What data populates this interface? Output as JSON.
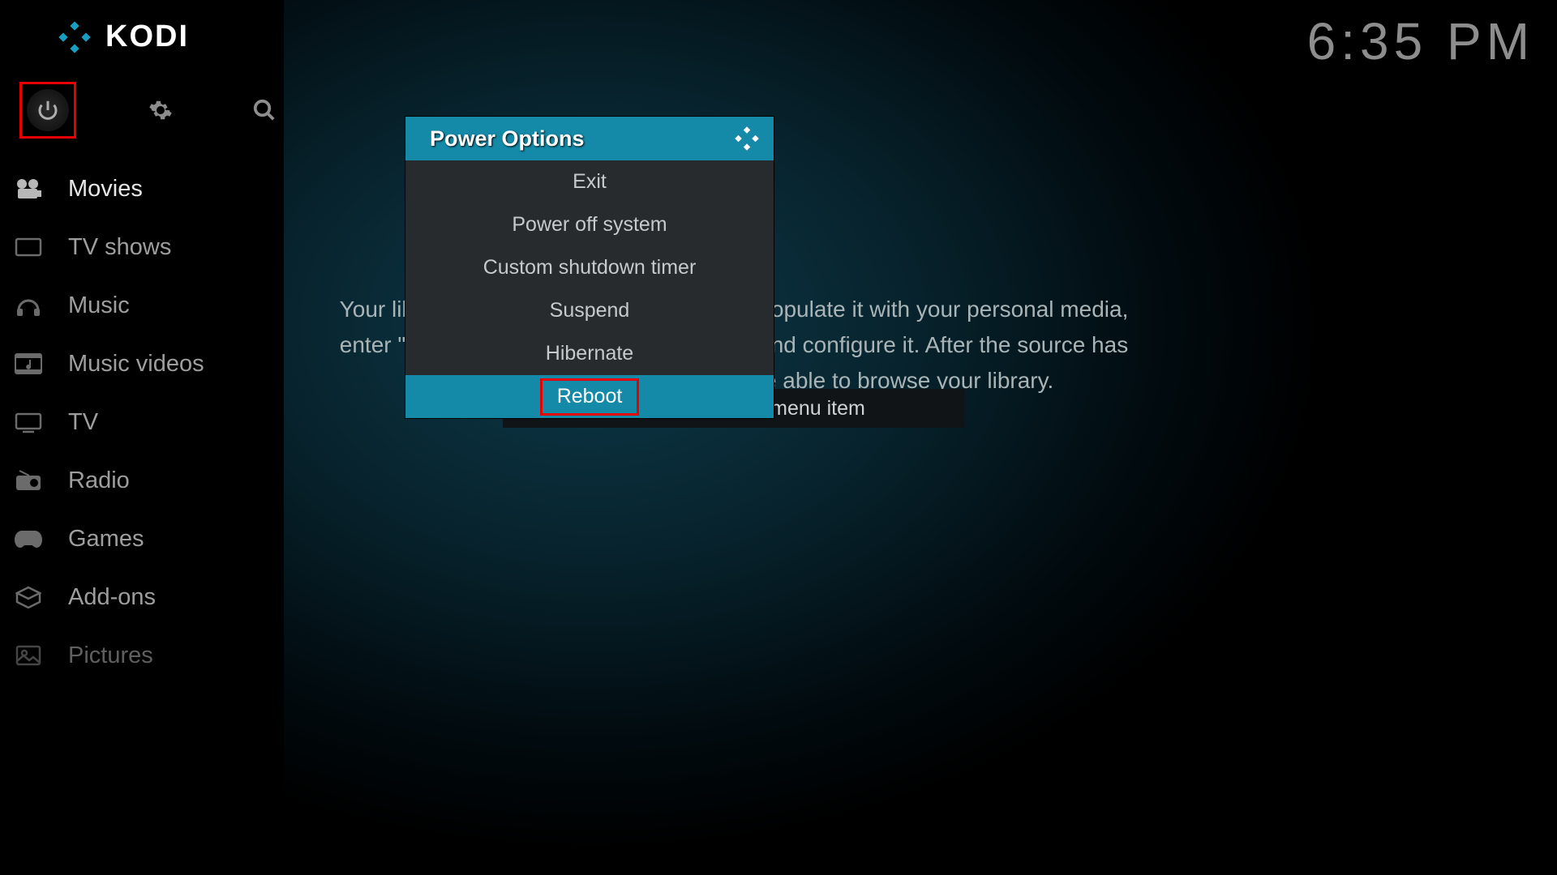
{
  "brand": "KODI",
  "clock": "6:35 PM",
  "sidebar": {
    "items": [
      {
        "label": "Movies"
      },
      {
        "label": "TV shows"
      },
      {
        "label": "Music"
      },
      {
        "label": "Music videos"
      },
      {
        "label": "TV"
      },
      {
        "label": "Radio"
      },
      {
        "label": "Games"
      },
      {
        "label": "Add-ons"
      },
      {
        "label": "Pictures"
      }
    ]
  },
  "main": {
    "empty_text": "Your library is currently empty. In order to populate it with your personal media, enter \"Files\" section, add a media source and configure it. After the source has been added and indexed you will be able to browse your library.",
    "remove_btn": "Remove this main menu item"
  },
  "dialog": {
    "title": "Power Options",
    "items": [
      {
        "label": "Exit"
      },
      {
        "label": "Power off system"
      },
      {
        "label": "Custom shutdown timer"
      },
      {
        "label": "Suspend"
      },
      {
        "label": "Hibernate"
      },
      {
        "label": "Reboot"
      }
    ]
  }
}
